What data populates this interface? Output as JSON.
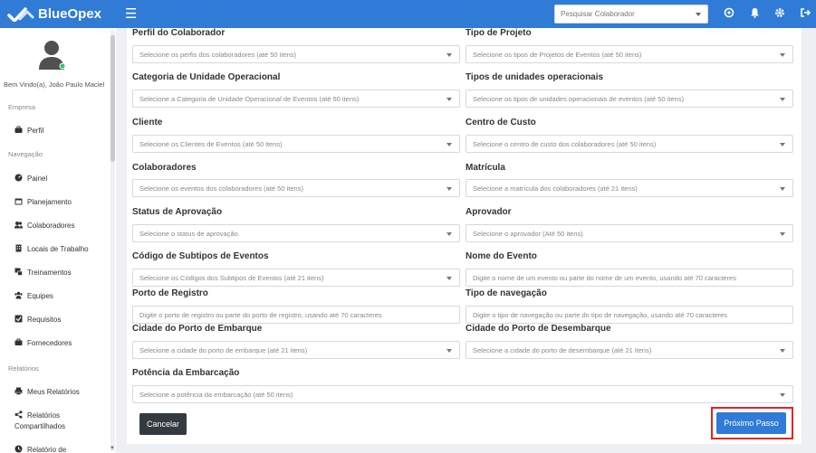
{
  "app": {
    "brand": "BlueOpex"
  },
  "topbar": {
    "search_placeholder": "Pesquisar Colaborador",
    "icons": [
      "support-icon",
      "bell-icon",
      "gear-icon",
      "logout-icon"
    ]
  },
  "sidebar": {
    "welcome": "Bem Vindo(a), João Paulo Maciel",
    "sections": {
      "empresa": "Empresa",
      "navegacao": "Navegação",
      "relatorios": "Relatórios"
    },
    "items": {
      "perfil": "Perfil",
      "painel": "Painel",
      "planejamento": "Planejamento",
      "colaboradores": "Colaboradores",
      "locais": "Locais de Trabalho",
      "treinamentos": "Treinamentos",
      "equipes": "Equipes",
      "requisitos": "Requisitos",
      "fornecedores": "Fornecedores",
      "meus_relatorios": "Meus Relatórios",
      "relatorios_compartilhados_1": "Relatórios",
      "relatorios_compartilhados_2": "Compartilhados",
      "relatorio_de": "Relatório de"
    }
  },
  "form": {
    "perfil": {
      "label": "Perfil do Colaborador",
      "placeholder": "Selecione os perfis dos colaboradores (até 50 itens)"
    },
    "tipo_projeto": {
      "label": "Tipo de Projeto",
      "placeholder": "Selecione os tipos de Projetos de Eventos (até 50 itens)"
    },
    "categoria": {
      "label": "Categoria de Unidade Operacional",
      "placeholder": "Selecione a Categoria de Unidade Operacional de Eventos (até 50 itens)"
    },
    "tipos_unidades": {
      "label": "Tipos de unidades operacionais",
      "placeholder": "Selecione os tipos de unidades operacionais de eventos (até 50 itens)"
    },
    "cliente": {
      "label": "Cliente",
      "placeholder": "Selecione os Clientes de Eventos (até 50 itens)"
    },
    "centro_custo": {
      "label": "Centro de Custo",
      "placeholder": "Selecione o centro de custo dos colaboradores (até 50 itens)"
    },
    "colaboradores": {
      "label": "Colaboradores",
      "placeholder": "Selecione os eventos dos colaboradores (até 50 itens)"
    },
    "matricula": {
      "label": "Matrícula",
      "placeholder": "Selecione a matrícula dos colaboradores (até 21 itens)"
    },
    "status": {
      "label": "Status de Aprovação",
      "placeholder": "Selecione o status de aprovação"
    },
    "aprovador": {
      "label": "Aprovador",
      "placeholder": "Selecione o aprovador (Até 50 itens)"
    },
    "subtipos": {
      "label": "Código de Subtipos de Eventos",
      "placeholder": "Selecione os Códigos dos Subtipos de Eventos (até 21 itens)"
    },
    "nome_evento": {
      "label": "Nome do Evento",
      "placeholder": "Digite o nome de um evento ou parte do nome de um evento, usando até 70 caracteres"
    },
    "porto_registro": {
      "label": "Porto de Registro",
      "placeholder": "Digite o porto de registro ou parte do porto de registro, usando até 70 caracteres"
    },
    "tipo_navegacao": {
      "label": "Tipo de navegação",
      "placeholder": "Digite o tipo de navegação ou parte do tipo de navegação, usando até 70 caracteres"
    },
    "cidade_embarque": {
      "label": "Cidade do Porto de Embarque",
      "placeholder": "Selecione a cidade do porto de embarque (até 21 itens)"
    },
    "cidade_desembarque": {
      "label": "Cidade do Porto de Desembarque",
      "placeholder": "Selecione a cidade do porto de desembarque (até 21 itens)"
    },
    "potencia": {
      "label": "Potência da Embarcação",
      "placeholder": "Selecione a potência da embarcação (até 50 itens)"
    }
  },
  "actions": {
    "cancel": "Cancelar",
    "next": "Próximo Passo"
  },
  "colors": {
    "primary": "#2f7bd6",
    "dark": "#333a40",
    "highlight": "#e02424",
    "online": "#28c76f"
  }
}
